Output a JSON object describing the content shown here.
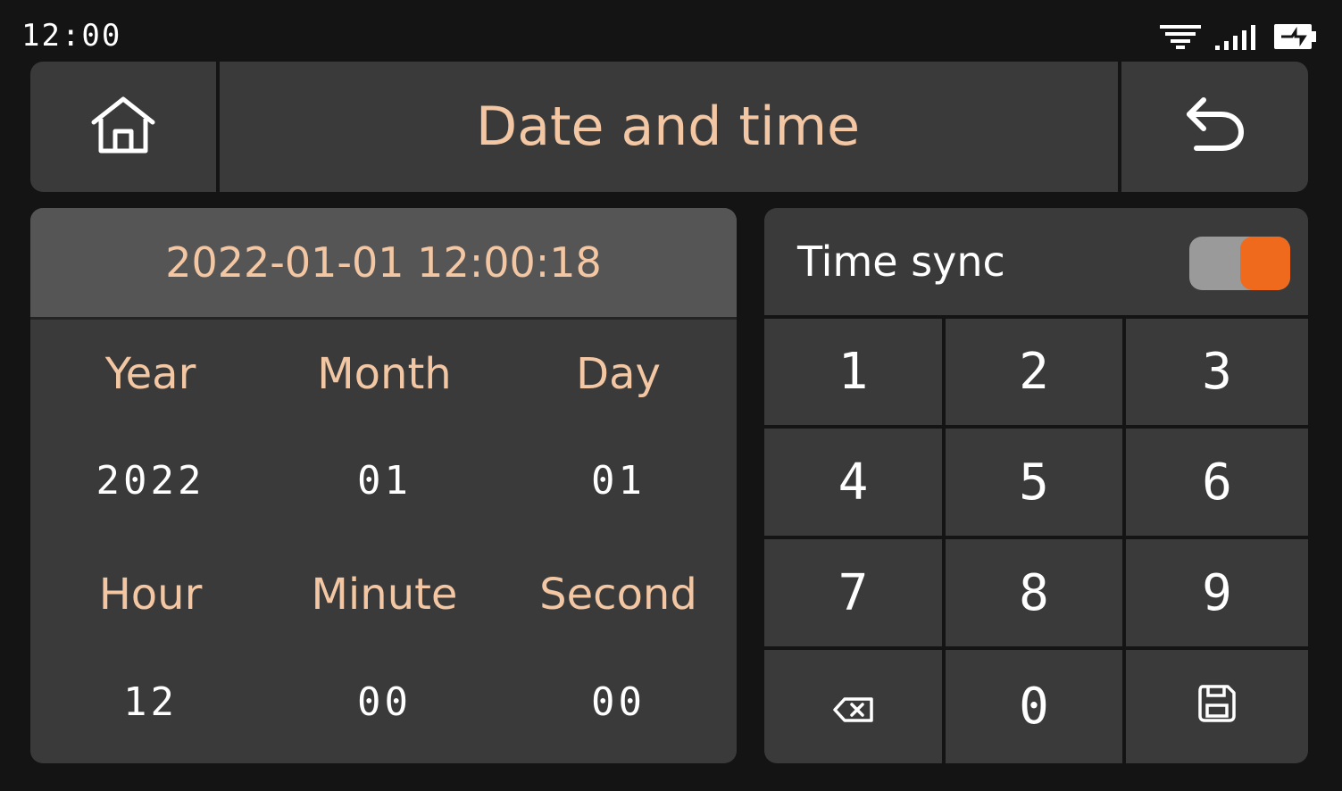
{
  "status_bar": {
    "time": "12:00",
    "icons": [
      "wifi-icon",
      "signal-icon",
      "battery-charging-icon"
    ]
  },
  "header": {
    "title": "Date and time",
    "home_icon": "home-icon",
    "back_icon": "back-icon"
  },
  "datetime": {
    "current": "2022-01-01 12:00:18",
    "fields": [
      {
        "label": "Year",
        "value": "2022"
      },
      {
        "label": "Month",
        "value": "01"
      },
      {
        "label": "Day",
        "value": "01"
      },
      {
        "label": "Hour",
        "value": "12"
      },
      {
        "label": "Minute",
        "value": "00"
      },
      {
        "label": "Second",
        "value": "00"
      }
    ]
  },
  "time_sync": {
    "label": "Time sync",
    "enabled": true
  },
  "keypad": {
    "keys": [
      "1",
      "2",
      "3",
      "4",
      "5",
      "6",
      "7",
      "8",
      "9",
      "",
      "0",
      ""
    ],
    "special_icons": [
      "backspace-icon",
      "save-icon"
    ]
  },
  "colors": {
    "background": "#141414",
    "panel": "#3a3a3a",
    "accent_text": "#f3c7a3",
    "toggle_on": "#ef6a1c",
    "toggle_track": "#9a9a9a"
  }
}
